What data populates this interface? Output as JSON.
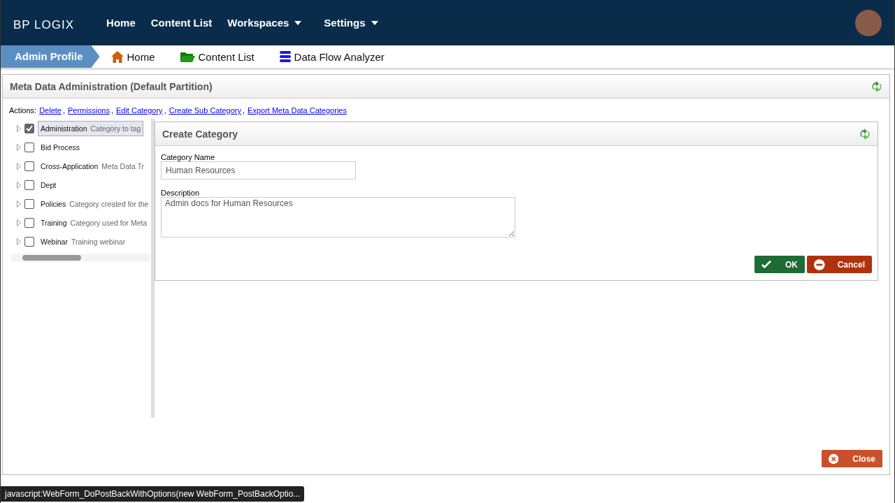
{
  "logo": "BP LOGIX",
  "nav": [
    {
      "label": "Home",
      "dropdown": false
    },
    {
      "label": "Content List",
      "dropdown": false
    },
    {
      "label": "Workspaces",
      "dropdown": true
    },
    {
      "label": "Settings",
      "dropdown": true
    }
  ],
  "breadcrumb": {
    "current": "Admin Profile",
    "links": [
      {
        "label": "Home",
        "kind": "home"
      },
      {
        "label": "Content List",
        "kind": "folder"
      },
      {
        "label": "Data Flow Analyzer",
        "kind": "database"
      }
    ]
  },
  "panel": {
    "title": "Meta Data Administration (Default Partition)",
    "actions_label": "Actions:",
    "action_separator": ",",
    "actions": [
      "Delete",
      "Permissions",
      "Edit Category",
      "Create Sub Category",
      "Export Meta Data Categories"
    ],
    "tree": [
      {
        "label": "Administration",
        "description": "Category to tag",
        "checked": true,
        "selected": true
      },
      {
        "label": "Bid Process",
        "checked": false,
        "selected": false
      },
      {
        "label": "Cross-Application",
        "description": "Meta Data Tr",
        "checked": false,
        "selected": false
      },
      {
        "label": "Dept",
        "checked": false,
        "selected": false
      },
      {
        "label": "Policies",
        "description": "Category created for the",
        "checked": false,
        "selected": false
      },
      {
        "label": "Training",
        "description": "Category used for Meta",
        "checked": false,
        "selected": false
      },
      {
        "label": "Webinar",
        "description": "Training webinar",
        "checked": false,
        "selected": false
      }
    ],
    "form": {
      "title": "Create Category",
      "name_label": "Category Name",
      "name_value": "Human Resources",
      "description_label": "Description",
      "description_value": "Admin docs for Human Resources",
      "ok": "OK",
      "cancel": "Cancel"
    },
    "close": "Close"
  },
  "status_bar": "javascript:WebForm_DoPostBackWithOptions(new WebForm_PostBackOptio..."
}
